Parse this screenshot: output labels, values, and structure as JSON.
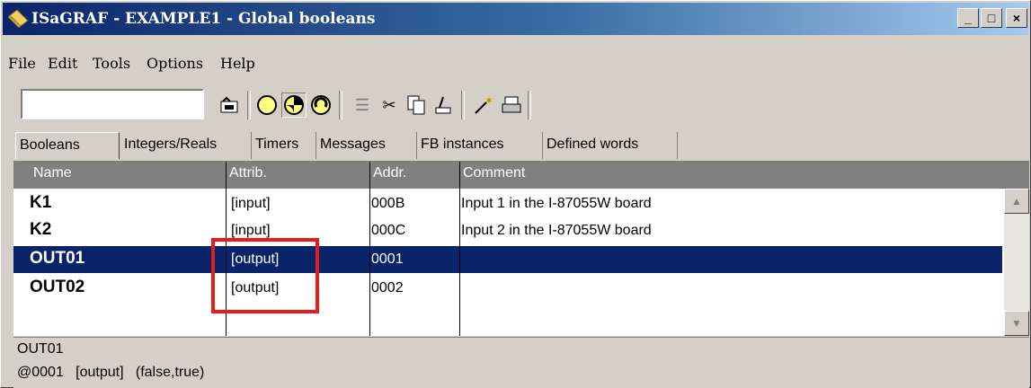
{
  "window": {
    "title": "ISaGRAF - EXAMPLE1 - Global booleans",
    "buttons": {
      "minimize": "_",
      "maximize": "□",
      "close": "×"
    }
  },
  "menu": [
    "File",
    "Edit",
    "Tools",
    "Options",
    "Help"
  ],
  "toolbar": {
    "input_value": "",
    "icons": [
      "folder-open-icon",
      "circle-empty-icon",
      "circle-half-icon",
      "circle-arrow-icon",
      "list-indent-icon",
      "cut-icon",
      "copy-icon",
      "paste-icon",
      "magic-wand-icon",
      "print-icon"
    ]
  },
  "tabs": [
    "Booleans",
    "Integers/Reals",
    "Timers",
    "Messages",
    "FB instances",
    "Defined words"
  ],
  "table": {
    "columns": [
      "Name",
      "Attrib.",
      "Addr.",
      "Comment"
    ],
    "rows": [
      {
        "name": "K1",
        "attrib": "[input]",
        "addr": "000B",
        "comment": "Input 1 in the I-87055W board"
      },
      {
        "name": "K2",
        "attrib": "[input]",
        "addr": "000C",
        "comment": "Input 2 in the I-87055W board"
      },
      {
        "name": "OUT01",
        "attrib": "[output]",
        "addr": "0001",
        "comment": ""
      },
      {
        "name": "OUT02",
        "attrib": "[output]",
        "addr": "0002",
        "comment": ""
      }
    ]
  },
  "status": {
    "line1": "OUT01",
    "line2": "@0001   [output]   (false,true)"
  },
  "colors": {
    "selection": "#0a246a",
    "highlight": "#e51c1c"
  }
}
